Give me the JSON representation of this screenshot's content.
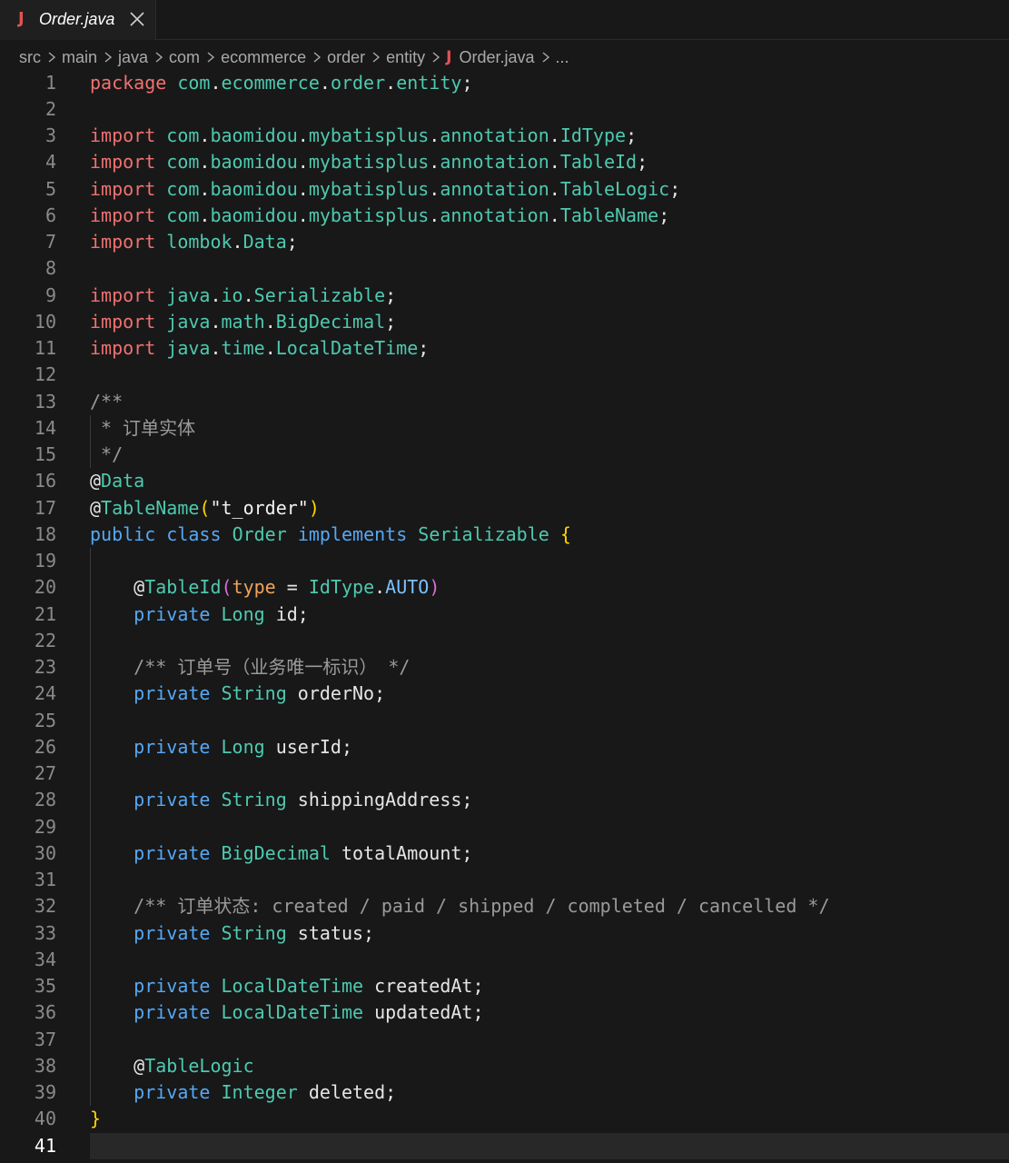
{
  "tab": {
    "icon": "J",
    "name": "Order.java"
  },
  "breadcrumb": [
    "src",
    "main",
    "java",
    "com",
    "ecommerce",
    "order",
    "entity"
  ],
  "breadcrumb_file": {
    "icon": "J",
    "name": "Order.java",
    "more": "..."
  },
  "active_line": 41,
  "lines": [
    [
      [
        "package",
        "kw-red"
      ],
      [
        " ",
        "ident"
      ],
      [
        "com",
        "pkg"
      ],
      [
        ".",
        "punc"
      ],
      [
        "ecommerce",
        "pkg"
      ],
      [
        ".",
        "punc"
      ],
      [
        "order",
        "pkg"
      ],
      [
        ".",
        "punc"
      ],
      [
        "entity",
        "pkg"
      ],
      [
        ";",
        "punc"
      ]
    ],
    [],
    [
      [
        "import",
        "kw-red"
      ],
      [
        " ",
        "ident"
      ],
      [
        "com",
        "pkg"
      ],
      [
        ".",
        "punc"
      ],
      [
        "baomidou",
        "pkg"
      ],
      [
        ".",
        "punc"
      ],
      [
        "mybatisplus",
        "pkg"
      ],
      [
        ".",
        "punc"
      ],
      [
        "annotation",
        "pkg"
      ],
      [
        ".",
        "punc"
      ],
      [
        "IdType",
        "ty"
      ],
      [
        ";",
        "punc"
      ]
    ],
    [
      [
        "import",
        "kw-red"
      ],
      [
        " ",
        "ident"
      ],
      [
        "com",
        "pkg"
      ],
      [
        ".",
        "punc"
      ],
      [
        "baomidou",
        "pkg"
      ],
      [
        ".",
        "punc"
      ],
      [
        "mybatisplus",
        "pkg"
      ],
      [
        ".",
        "punc"
      ],
      [
        "annotation",
        "pkg"
      ],
      [
        ".",
        "punc"
      ],
      [
        "TableId",
        "ty"
      ],
      [
        ";",
        "punc"
      ]
    ],
    [
      [
        "import",
        "kw-red"
      ],
      [
        " ",
        "ident"
      ],
      [
        "com",
        "pkg"
      ],
      [
        ".",
        "punc"
      ],
      [
        "baomidou",
        "pkg"
      ],
      [
        ".",
        "punc"
      ],
      [
        "mybatisplus",
        "pkg"
      ],
      [
        ".",
        "punc"
      ],
      [
        "annotation",
        "pkg"
      ],
      [
        ".",
        "punc"
      ],
      [
        "TableLogic",
        "ty"
      ],
      [
        ";",
        "punc"
      ]
    ],
    [
      [
        "import",
        "kw-red"
      ],
      [
        " ",
        "ident"
      ],
      [
        "com",
        "pkg"
      ],
      [
        ".",
        "punc"
      ],
      [
        "baomidou",
        "pkg"
      ],
      [
        ".",
        "punc"
      ],
      [
        "mybatisplus",
        "pkg"
      ],
      [
        ".",
        "punc"
      ],
      [
        "annotation",
        "pkg"
      ],
      [
        ".",
        "punc"
      ],
      [
        "TableName",
        "ty"
      ],
      [
        ";",
        "punc"
      ]
    ],
    [
      [
        "import",
        "kw-red"
      ],
      [
        " ",
        "ident"
      ],
      [
        "lombok",
        "pkg"
      ],
      [
        ".",
        "punc"
      ],
      [
        "Data",
        "ty"
      ],
      [
        ";",
        "punc"
      ]
    ],
    [],
    [
      [
        "import",
        "kw-red"
      ],
      [
        " ",
        "ident"
      ],
      [
        "java",
        "pkg"
      ],
      [
        ".",
        "punc"
      ],
      [
        "io",
        "pkg"
      ],
      [
        ".",
        "punc"
      ],
      [
        "Serializable",
        "ty"
      ],
      [
        ";",
        "punc"
      ]
    ],
    [
      [
        "import",
        "kw-red"
      ],
      [
        " ",
        "ident"
      ],
      [
        "java",
        "pkg"
      ],
      [
        ".",
        "punc"
      ],
      [
        "math",
        "pkg"
      ],
      [
        ".",
        "punc"
      ],
      [
        "BigDecimal",
        "ty"
      ],
      [
        ";",
        "punc"
      ]
    ],
    [
      [
        "import",
        "kw-red"
      ],
      [
        " ",
        "ident"
      ],
      [
        "java",
        "pkg"
      ],
      [
        ".",
        "punc"
      ],
      [
        "time",
        "pkg"
      ],
      [
        ".",
        "punc"
      ],
      [
        "LocalDateTime",
        "ty"
      ],
      [
        ";",
        "punc"
      ]
    ],
    [],
    [
      [
        "/**",
        "cmt"
      ]
    ],
    [
      [
        " * 订单实体",
        "cmt"
      ]
    ],
    [
      [
        " */",
        "cmt"
      ]
    ],
    [
      [
        "@",
        "ann-at"
      ],
      [
        "Data",
        "ann"
      ]
    ],
    [
      [
        "@",
        "ann-at"
      ],
      [
        "TableName",
        "ann"
      ],
      [
        "(",
        "paren-y"
      ],
      [
        "\"t_order\"",
        "str"
      ],
      [
        ")",
        "paren-y"
      ]
    ],
    [
      [
        "public",
        "kw-blue"
      ],
      [
        " ",
        "ident"
      ],
      [
        "class",
        "kw-blue"
      ],
      [
        " ",
        "ident"
      ],
      [
        "Order",
        "ty"
      ],
      [
        " ",
        "ident"
      ],
      [
        "implements",
        "kw-blue"
      ],
      [
        " ",
        "ident"
      ],
      [
        "Serializable",
        "ty"
      ],
      [
        " ",
        "ident"
      ],
      [
        "{",
        "brace-y"
      ]
    ],
    [],
    [
      [
        "    ",
        "ident"
      ],
      [
        "@",
        "ann-at"
      ],
      [
        "TableId",
        "ann"
      ],
      [
        "(",
        "paren-p"
      ],
      [
        "type",
        "attr"
      ],
      [
        " = ",
        "punc"
      ],
      [
        "IdType",
        "ty"
      ],
      [
        ".",
        "punc"
      ],
      [
        "AUTO",
        "const"
      ],
      [
        ")",
        "paren-p"
      ]
    ],
    [
      [
        "    ",
        "ident"
      ],
      [
        "private",
        "kw-blue"
      ],
      [
        " ",
        "ident"
      ],
      [
        "Long",
        "ty"
      ],
      [
        " id;",
        "ident"
      ]
    ],
    [],
    [
      [
        "    ",
        "ident"
      ],
      [
        "/** 订单号（业务唯一标识） */",
        "cmt"
      ]
    ],
    [
      [
        "    ",
        "ident"
      ],
      [
        "private",
        "kw-blue"
      ],
      [
        " ",
        "ident"
      ],
      [
        "String",
        "ty"
      ],
      [
        " orderNo;",
        "ident"
      ]
    ],
    [],
    [
      [
        "    ",
        "ident"
      ],
      [
        "private",
        "kw-blue"
      ],
      [
        " ",
        "ident"
      ],
      [
        "Long",
        "ty"
      ],
      [
        " userId;",
        "ident"
      ]
    ],
    [],
    [
      [
        "    ",
        "ident"
      ],
      [
        "private",
        "kw-blue"
      ],
      [
        " ",
        "ident"
      ],
      [
        "String",
        "ty"
      ],
      [
        " shippingAddress;",
        "ident"
      ]
    ],
    [],
    [
      [
        "    ",
        "ident"
      ],
      [
        "private",
        "kw-blue"
      ],
      [
        " ",
        "ident"
      ],
      [
        "BigDecimal",
        "ty"
      ],
      [
        " totalAmount;",
        "ident"
      ]
    ],
    [],
    [
      [
        "    ",
        "ident"
      ],
      [
        "/** 订单状态: created / paid / shipped / completed / cancelled */",
        "cmt"
      ]
    ],
    [
      [
        "    ",
        "ident"
      ],
      [
        "private",
        "kw-blue"
      ],
      [
        " ",
        "ident"
      ],
      [
        "String",
        "ty"
      ],
      [
        " status;",
        "ident"
      ]
    ],
    [],
    [
      [
        "    ",
        "ident"
      ],
      [
        "private",
        "kw-blue"
      ],
      [
        " ",
        "ident"
      ],
      [
        "LocalDateTime",
        "ty"
      ],
      [
        " createdAt;",
        "ident"
      ]
    ],
    [
      [
        "    ",
        "ident"
      ],
      [
        "private",
        "kw-blue"
      ],
      [
        " ",
        "ident"
      ],
      [
        "LocalDateTime",
        "ty"
      ],
      [
        " updatedAt;",
        "ident"
      ]
    ],
    [],
    [
      [
        "    ",
        "ident"
      ],
      [
        "@",
        "ann-at"
      ],
      [
        "TableLogic",
        "ann"
      ]
    ],
    [
      [
        "    ",
        "ident"
      ],
      [
        "private",
        "kw-blue"
      ],
      [
        " ",
        "ident"
      ],
      [
        "Integer",
        "ty"
      ],
      [
        " deleted;",
        "ident"
      ]
    ],
    [
      [
        "}",
        "brace-y"
      ]
    ],
    []
  ]
}
